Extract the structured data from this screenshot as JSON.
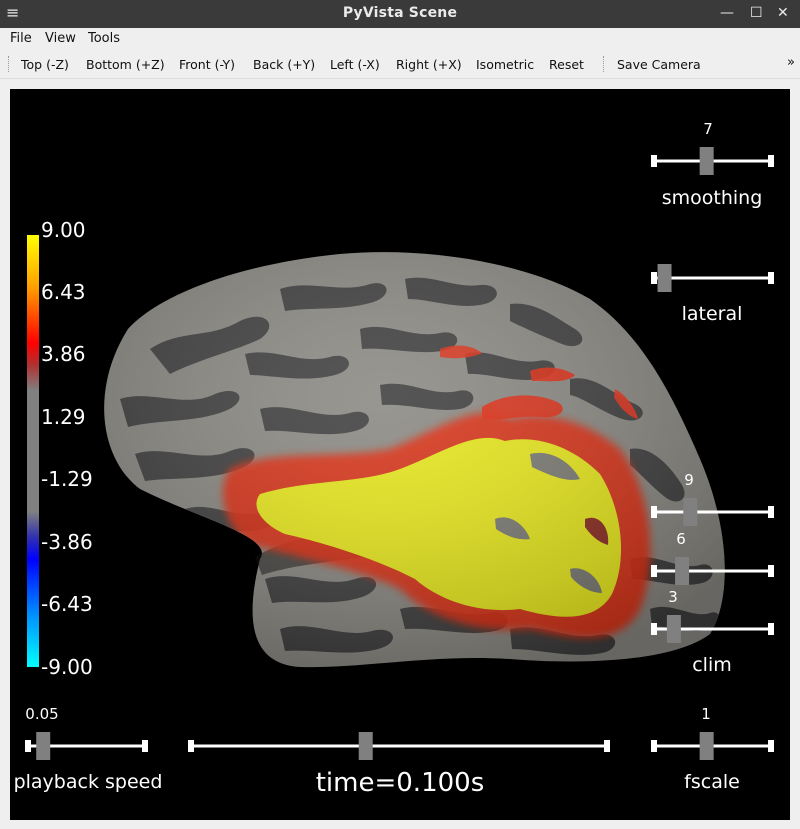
{
  "window": {
    "title": "PyVista Scene",
    "menu_icon": "hamburger-menu-icon",
    "controls": [
      "minimize-icon",
      "maximize-icon",
      "close-icon"
    ]
  },
  "menubar": {
    "items": [
      "File",
      "View",
      "Tools"
    ]
  },
  "toolbar": {
    "buttons": [
      "Top (-Z)",
      "Bottom (+Z)",
      "Front (-Y)",
      "Back (+Y)",
      "Left (-X)",
      "Right (+X)",
      "Isometric",
      "Reset"
    ],
    "save_camera": "Save Camera",
    "overflow": "»"
  },
  "colorbar": {
    "ticks": [
      "9.00",
      "6.43",
      "3.86",
      "1.29",
      "-1.29",
      "-3.86",
      "-6.43",
      "-9.00"
    ],
    "colors": {
      "top": "#ffff00",
      "upper": "#ff0000",
      "mid": "#808080",
      "lower": "#0000ff",
      "bottom": "#00ffff"
    }
  },
  "sliders": {
    "smoothing": {
      "label": "smoothing",
      "value": "7",
      "fraction": 0.45
    },
    "lateral": {
      "label": "lateral",
      "fraction": 0.09
    },
    "clim": {
      "label": "clim",
      "high": {
        "value": "9",
        "fraction": 0.31
      },
      "mid": {
        "value": "6",
        "fraction": 0.24
      },
      "low": {
        "value": "3",
        "fraction": 0.17
      }
    },
    "playback_speed": {
      "label": "playback speed",
      "value": "0.05",
      "fraction": 0.13
    },
    "time": {
      "label": "time=0.100s",
      "fraction": 0.42
    },
    "fscale": {
      "label": "fscale",
      "value": "1",
      "fraction": 0.45
    }
  },
  "scene": {
    "surface_colors": {
      "gyri": "#8c8a84",
      "sulci": "#3f3f3f",
      "activation_core": "#e8e81a",
      "activation_edge": "#e02a10"
    }
  }
}
